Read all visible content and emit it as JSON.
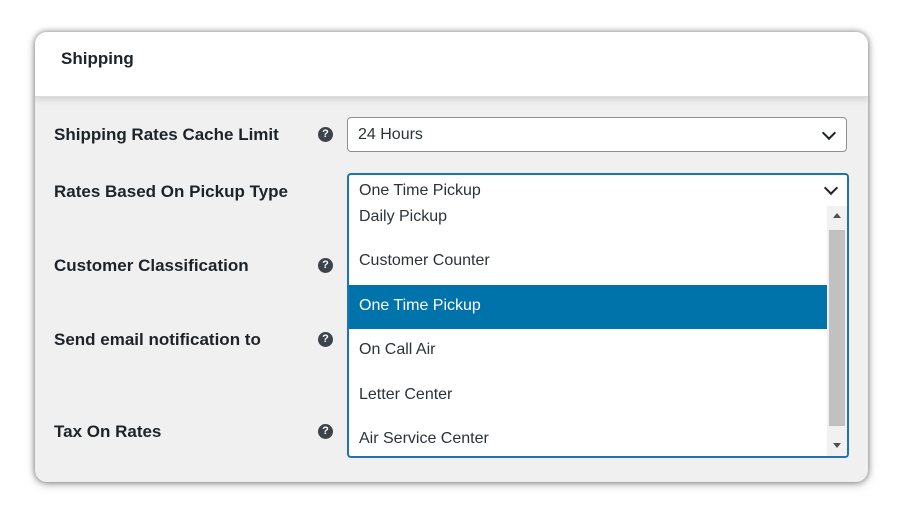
{
  "card": {
    "title": "Shipping"
  },
  "rows": [
    {
      "label": "Shipping Rates Cache Limit",
      "help": "?"
    },
    {
      "label": "Rates Based On Pickup Type"
    },
    {
      "label": "Customer Classification",
      "help": "?"
    },
    {
      "label": "Send email notification to",
      "help": "?"
    },
    {
      "label": "Tax On Rates",
      "help": "?"
    }
  ],
  "cache_select": {
    "value": "24 Hours"
  },
  "pickup_select": {
    "value": "One Time Pickup",
    "options": [
      "Daily Pickup",
      "Customer Counter",
      "One Time Pickup",
      "On Call Air",
      "Letter Center",
      "Air Service Center"
    ],
    "highlighted_option": "One Time Pickup"
  },
  "colors": {
    "accent": "#2271b1",
    "highlight": "#0073aa",
    "help_icon": "#3c434a"
  }
}
